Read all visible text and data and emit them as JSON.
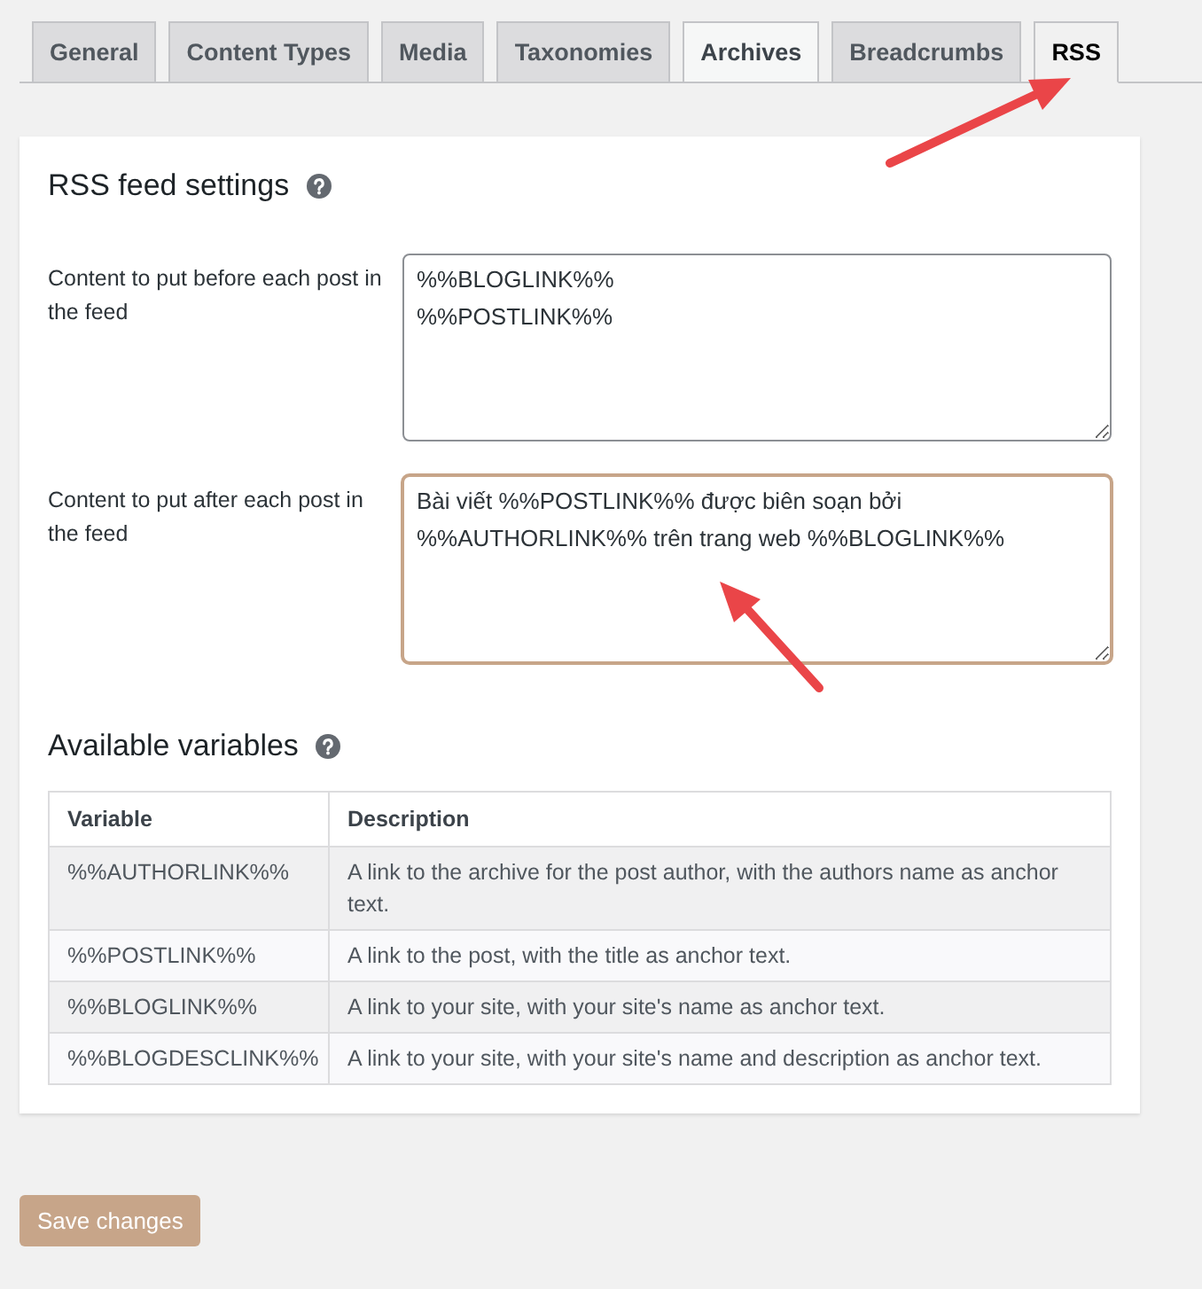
{
  "tabs": [
    {
      "label": "General",
      "selected": false,
      "hovered": false
    },
    {
      "label": "Content Types",
      "selected": false,
      "hovered": false
    },
    {
      "label": "Media",
      "selected": false,
      "hovered": false
    },
    {
      "label": "Taxonomies",
      "selected": false,
      "hovered": false
    },
    {
      "label": "Archives",
      "selected": false,
      "hovered": true
    },
    {
      "label": "Breadcrumbs",
      "selected": false,
      "hovered": false
    },
    {
      "label": "RSS",
      "selected": true,
      "hovered": false
    }
  ],
  "rss_settings": {
    "title": "RSS feed settings",
    "fields": [
      {
        "label": "Content to put before each post in the feed",
        "value": "%%BLOGLINK%%\n%%POSTLINK%%",
        "focused": false
      },
      {
        "label": "Content to put after each post in the feed",
        "value": "Bài viết %%POSTLINK%% được biên soạn bởi %%AUTHORLINK%% trên trang web %%BLOGLINK%%",
        "focused": true
      }
    ]
  },
  "variables": {
    "title": "Available variables",
    "columns": [
      "Variable",
      "Description"
    ],
    "rows": [
      {
        "variable": "%%AUTHORLINK%%",
        "description": "A link to the archive for the post author, with the authors name as anchor text."
      },
      {
        "variable": "%%POSTLINK%%",
        "description": "A link to the post, with the title as anchor text."
      },
      {
        "variable": "%%BLOGLINK%%",
        "description": "A link to your site, with your site's name as anchor text."
      },
      {
        "variable": "%%BLOGDESCLINK%%",
        "description": "A link to your site, with your site's name and description as anchor text."
      }
    ]
  },
  "save_button": "Save changes"
}
